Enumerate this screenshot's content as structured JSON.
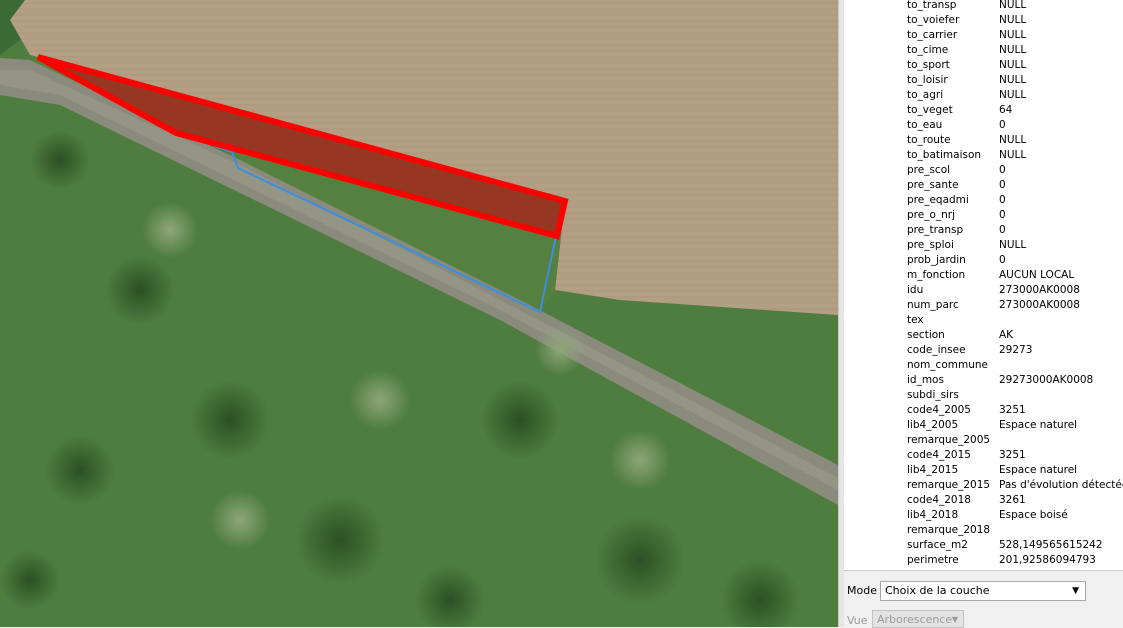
{
  "attributes": [
    {
      "field": "to_transp",
      "value": "NULL"
    },
    {
      "field": "to_voiefer",
      "value": "NULL"
    },
    {
      "field": "to_carrier",
      "value": "NULL"
    },
    {
      "field": "to_cime",
      "value": "NULL"
    },
    {
      "field": "to_sport",
      "value": "NULL"
    },
    {
      "field": "to_loisir",
      "value": "NULL"
    },
    {
      "field": "to_agri",
      "value": "NULL"
    },
    {
      "field": "to_veget",
      "value": "64"
    },
    {
      "field": "to_eau",
      "value": "0"
    },
    {
      "field": "to_route",
      "value": "NULL"
    },
    {
      "field": "to_batimaison",
      "value": "NULL"
    },
    {
      "field": "pre_scol",
      "value": "0"
    },
    {
      "field": "pre_sante",
      "value": "0"
    },
    {
      "field": "pre_eqadmi",
      "value": "0"
    },
    {
      "field": "pre_o_nrj",
      "value": "0"
    },
    {
      "field": "pre_transp",
      "value": "0"
    },
    {
      "field": "pre_sploi",
      "value": "NULL"
    },
    {
      "field": "prob_jardin",
      "value": "0"
    },
    {
      "field": "m_fonction",
      "value": "AUCUN LOCAL"
    },
    {
      "field": "idu",
      "value": "273000AK0008"
    },
    {
      "field": "num_parc",
      "value": "273000AK0008"
    },
    {
      "field": "tex",
      "value": ""
    },
    {
      "field": "section",
      "value": "AK"
    },
    {
      "field": "code_insee",
      "value": "29273"
    },
    {
      "field": "nom_commune",
      "value": ""
    },
    {
      "field": "id_mos",
      "value": "29273000AK0008"
    },
    {
      "field": "subdi_sirs",
      "value": ""
    },
    {
      "field": "code4_2005",
      "value": "3251"
    },
    {
      "field": "lib4_2005",
      "value": "Espace naturel"
    },
    {
      "field": "remarque_2005",
      "value": ""
    },
    {
      "field": "code4_2015",
      "value": "3251"
    },
    {
      "field": "lib4_2015",
      "value": "Espace naturel"
    },
    {
      "field": "remarque_2015",
      "value": "Pas d'évolution détectée"
    },
    {
      "field": "code4_2018",
      "value": "3261"
    },
    {
      "field": "lib4_2018",
      "value": "Espace boisé"
    },
    {
      "field": "remarque_2018",
      "value": ""
    },
    {
      "field": "surface_m2",
      "value": "528,149565615242"
    },
    {
      "field": "perimetre",
      "value": "201,92586094793"
    }
  ],
  "mode": {
    "label": "Mode",
    "value": "Choix de la couche"
  },
  "vue": {
    "label": "Vue",
    "value": "Arborescence"
  },
  "colors": {
    "selection_outline": "#ff0000",
    "selection_fill": "#b01818",
    "parcel_outline": "#3c8ee0",
    "field": "#b39f84",
    "grass": "#4f7d40",
    "road": "#8e8e80"
  }
}
